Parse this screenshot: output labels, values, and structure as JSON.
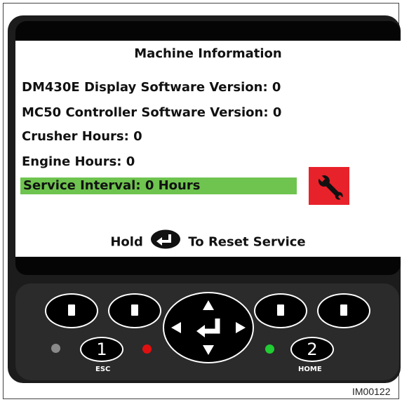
{
  "screen": {
    "title": "Machine Information",
    "lines": [
      "DM430E Display Software Version: 0",
      "MC50 Controller Software Version: 0",
      "Crusher Hours: 0",
      "Engine Hours: 0"
    ],
    "service_interval": "Service Interval: 0 Hours",
    "hold_prefix": "Hold",
    "hold_suffix": "To Reset Service",
    "service_bar_color": "#6ec44f",
    "wrench_box_color": "#e8222a"
  },
  "keypad": {
    "key1_label": "1",
    "key1_sub": "ESC",
    "key2_label": "2",
    "key2_sub": "HOME",
    "led_colors": {
      "left": "#8a8a8a",
      "red": "#e01010",
      "green": "#22cc33"
    },
    "icons": [
      "up-arrow-icon",
      "down-arrow-icon",
      "left-arrow-icon",
      "right-arrow-icon",
      "enter-icon"
    ]
  },
  "image_code": "IM00122"
}
